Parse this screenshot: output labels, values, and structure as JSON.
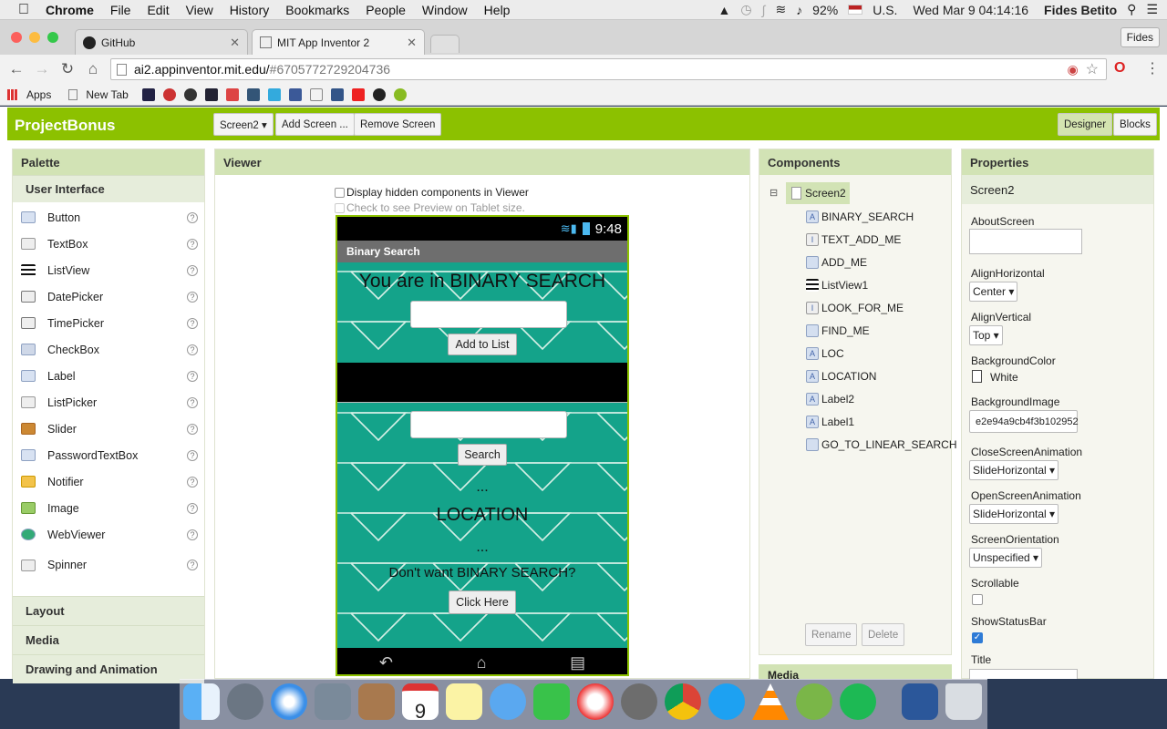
{
  "menubar": {
    "app": "Chrome",
    "items": [
      "File",
      "Edit",
      "View",
      "History",
      "Bookmarks",
      "People",
      "Window",
      "Help"
    ],
    "battery": "92%",
    "input_source": "U.S.",
    "clock": "Wed Mar 9  04:14:16",
    "user": "Fides Betito"
  },
  "browser": {
    "tabs": [
      {
        "title": "GitHub"
      },
      {
        "title": "MIT App Inventor 2"
      }
    ],
    "profile_button": "Fides",
    "url_host": "ai2.appinventor.mit.edu/",
    "url_path": "#6705772729204736",
    "bookmarks": [
      "Apps",
      "New Tab"
    ]
  },
  "appinventor": {
    "project": "ProjectBonus",
    "screen_select": "Screen2 ▾",
    "add_screen": "Add Screen ...",
    "remove_screen": "Remove Screen",
    "designer": "Designer",
    "blocks": "Blocks",
    "palette": {
      "title": "Palette",
      "section": "User Interface",
      "items": [
        "Button",
        "TextBox",
        "ListView",
        "DatePicker",
        "TimePicker",
        "CheckBox",
        "Label",
        "ListPicker",
        "Slider",
        "PasswordTextBox",
        "Notifier",
        "Image",
        "WebViewer",
        "Spinner"
      ],
      "collapsed": [
        "Layout",
        "Media",
        "Drawing and Animation"
      ]
    },
    "viewer": {
      "title": "Viewer",
      "show_hidden": "Display hidden components in Viewer",
      "tablet_preview": "Check to see Preview on Tablet size.",
      "phone": {
        "time": "9:48",
        "screen_title": "Binary Search",
        "heading": "You are in BINARY SEARCH",
        "add_button": "Add to List",
        "search_button": "Search",
        "dots1": "...",
        "location": "LOCATION",
        "dots2": "...",
        "question": "Don't want BINARY SEARCH?",
        "click_button": "Click Here"
      }
    },
    "components": {
      "title": "Components",
      "root": "Screen2",
      "items": [
        "BINARY_SEARCH",
        "TEXT_ADD_ME",
        "ADD_ME",
        "ListView1",
        "LOOK_FOR_ME",
        "FIND_ME",
        "LOC",
        "LOCATION",
        "Label2",
        "Label1",
        "GO_TO_LINEAR_SEARCH"
      ],
      "rename": "Rename",
      "delete": "Delete",
      "media_peek": "Media"
    },
    "properties": {
      "title": "Properties",
      "component": "Screen2",
      "about_label": "AboutScreen",
      "align_h_label": "AlignHorizontal",
      "align_h": "Center ▾",
      "align_v_label": "AlignVertical",
      "align_v": "Top ▾",
      "bg_color_label": "BackgroundColor",
      "bg_color": "White",
      "bg_image_label": "BackgroundImage",
      "bg_image": "e2e94a9cb4f3b102952",
      "close_anim_label": "CloseScreenAnimation",
      "close_anim": "SlideHorizontal ▾",
      "open_anim_label": "OpenScreenAnimation",
      "open_anim": "SlideHorizontal ▾",
      "orientation_label": "ScreenOrientation",
      "orientation": "Unspecified ▾",
      "scrollable_label": "Scrollable",
      "scrollable": false,
      "statusbar_label": "ShowStatusBar",
      "statusbar": true,
      "title_label": "Title"
    }
  },
  "colors": {
    "accent": "#8cc100",
    "phone_bg": "#14a38a",
    "panel_header": "#d2e3b5"
  }
}
